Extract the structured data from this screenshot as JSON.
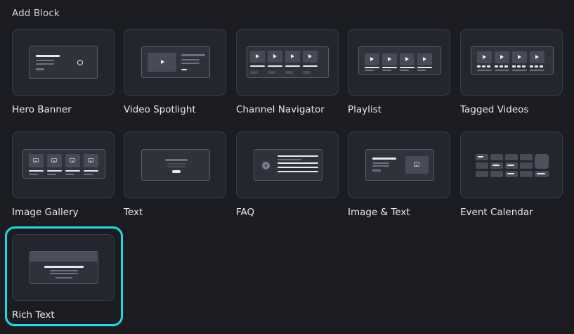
{
  "header": {
    "title": "Add Block"
  },
  "blocks": [
    {
      "label": "Hero Banner",
      "icon": "hero-banner-icon"
    },
    {
      "label": "Video Spotlight",
      "icon": "video-spotlight-icon"
    },
    {
      "label": "Channel Navigator",
      "icon": "channel-navigator-icon"
    },
    {
      "label": "Playlist",
      "icon": "playlist-icon"
    },
    {
      "label": "Tagged Videos",
      "icon": "tagged-videos-icon"
    },
    {
      "label": "Image Gallery",
      "icon": "image-gallery-icon"
    },
    {
      "label": "Text",
      "icon": "text-block-icon"
    },
    {
      "label": "FAQ",
      "icon": "faq-icon"
    },
    {
      "label": "Image & Text",
      "icon": "image-text-icon"
    },
    {
      "label": "Event Calendar",
      "icon": "event-calendar-icon"
    },
    {
      "label": "Rich Text",
      "icon": "rich-text-icon",
      "selected": true
    }
  ],
  "colors": {
    "background": "#1b1c21",
    "card": "#24262d",
    "card_border": "#3a3c44",
    "selection": "#29d6e6"
  }
}
